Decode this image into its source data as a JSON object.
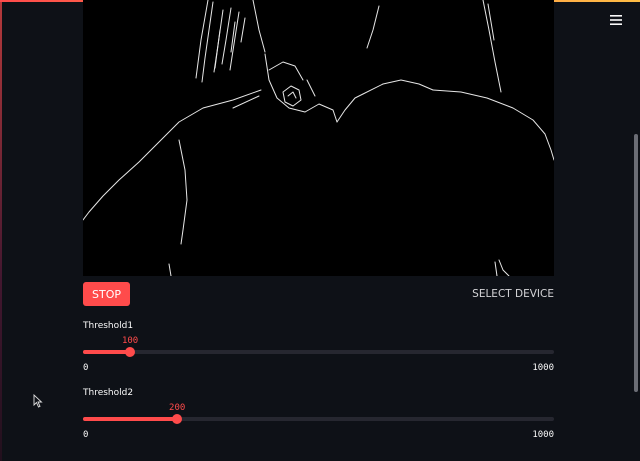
{
  "header": {
    "menu_icon": "hamburger-icon"
  },
  "video": {
    "icon": "edge-detected-video-feed"
  },
  "controls": {
    "stop_label": "STOP",
    "select_device_label": "SELECT DEVICE"
  },
  "sliders": [
    {
      "label": "Threshold1",
      "value": 100,
      "min": 0,
      "max": 1000,
      "value_text": "100",
      "min_text": "0",
      "max_text": "1000"
    },
    {
      "label": "Threshold2",
      "value": 200,
      "min": 0,
      "max": 1000,
      "value_text": "200",
      "min_text": "0",
      "max_text": "1000"
    }
  ],
  "colors": {
    "accent": "#ff4b4b",
    "background": "#0e1117",
    "track": "#262730"
  }
}
